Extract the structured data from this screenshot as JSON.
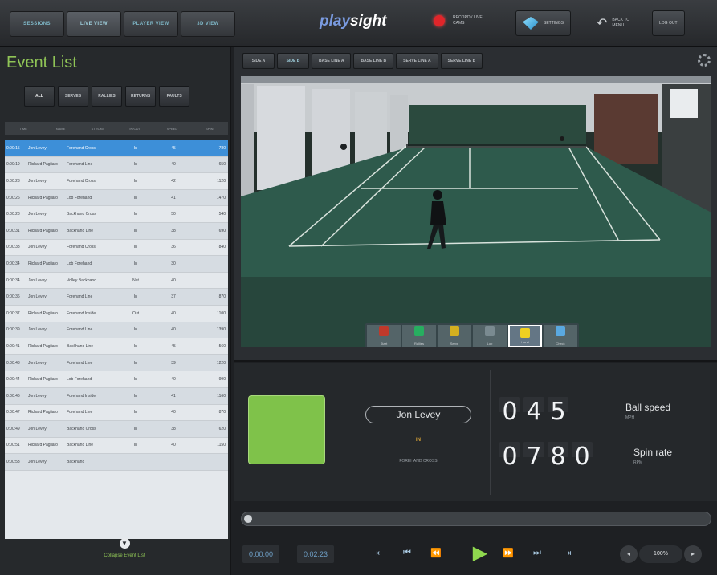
{
  "topbar": {
    "nav_tabs": [
      {
        "label": "SESSIONS",
        "active": false
      },
      {
        "label": "LIVE VIEW",
        "active": true
      },
      {
        "label": "PLAYER VIEW",
        "active": false
      },
      {
        "label": "3D VIEW",
        "active": false
      }
    ],
    "brand_prefix": "play",
    "brand_suffix": "sight",
    "record_text": "RECORD / LIVE CAMS",
    "settings_label": "SETTINGS",
    "back_label": "BACK TO MENU",
    "logout_label": "LOG OUT"
  },
  "event_list": {
    "title": "Event List",
    "filters": [
      "ALL",
      "SERVES",
      "RALLIES",
      "RETURNS",
      "FAULTS"
    ],
    "active_filter": "ALL",
    "columns": [
      "TIME",
      "NAME",
      "STROKE",
      "IN/OUT",
      "SPEED",
      "SPIN"
    ],
    "rows": [
      {
        "time": "0:00:15",
        "name": "Jon Levey",
        "stroke": "Forehand Cross",
        "inout": "In",
        "speed": "45",
        "spin": "780"
      },
      {
        "time": "0:00:19",
        "name": "Richard Pagliaro",
        "stroke": "Forehand Line",
        "inout": "In",
        "speed": "40",
        "spin": "650"
      },
      {
        "time": "0:00:23",
        "name": "Jon Levey",
        "stroke": "Forehand Cross",
        "inout": "In",
        "speed": "42",
        "spin": "1120"
      },
      {
        "time": "0:00:26",
        "name": "Richard Pagliaro",
        "stroke": "Lob Forehand",
        "inout": "In",
        "speed": "41",
        "spin": "1470"
      },
      {
        "time": "0:00:28",
        "name": "Jon Levey",
        "stroke": "Backhand Cross",
        "inout": "In",
        "speed": "50",
        "spin": "540"
      },
      {
        "time": "0:00:31",
        "name": "Richard Pagliaro",
        "stroke": "Backhand Line",
        "inout": "In",
        "speed": "38",
        "spin": "690"
      },
      {
        "time": "0:00:33",
        "name": "Jon Levey",
        "stroke": "Forehand Cross",
        "inout": "In",
        "speed": "36",
        "spin": "840"
      },
      {
        "time": "0:00:34",
        "name": "Richard Pagliaro",
        "stroke": "Lob Forehand",
        "inout": "In",
        "speed": "30",
        "spin": ""
      },
      {
        "time": "0:00:34",
        "name": "Jon Levey",
        "stroke": "Volley Backhand",
        "inout": "Net",
        "speed": "40",
        "spin": ""
      },
      {
        "time": "0:00:36",
        "name": "Jon Levey",
        "stroke": "Forehand Line",
        "inout": "In",
        "speed": "37",
        "spin": "870"
      },
      {
        "time": "0:00:37",
        "name": "Richard Pagliaro",
        "stroke": "Forehand Inside",
        "inout": "Out",
        "speed": "40",
        "spin": "1100"
      },
      {
        "time": "0:00:39",
        "name": "Jon Levey",
        "stroke": "Forehand Line",
        "inout": "In",
        "speed": "40",
        "spin": "1390"
      },
      {
        "time": "0:00:41",
        "name": "Richard Pagliaro",
        "stroke": "Backhand Line",
        "inout": "In",
        "speed": "45",
        "spin": "560"
      },
      {
        "time": "0:00:43",
        "name": "Jon Levey",
        "stroke": "Forehand Line",
        "inout": "In",
        "speed": "39",
        "spin": "1220"
      },
      {
        "time": "0:00:44",
        "name": "Richard Pagliaro",
        "stroke": "Lob Forehand",
        "inout": "In",
        "speed": "40",
        "spin": "990"
      },
      {
        "time": "0:00:46",
        "name": "Jon Levey",
        "stroke": "Forehand Inside",
        "inout": "In",
        "speed": "41",
        "spin": "1160"
      },
      {
        "time": "0:00:47",
        "name": "Richard Pagliaro",
        "stroke": "Forehand Line",
        "inout": "In",
        "speed": "40",
        "spin": "870"
      },
      {
        "time": "0:00:49",
        "name": "Jon Levey",
        "stroke": "Backhand Cross",
        "inout": "In",
        "speed": "38",
        "spin": "620"
      },
      {
        "time": "0:00:51",
        "name": "Richard Pagliaro",
        "stroke": "Backhand Line",
        "inout": "In",
        "speed": "40",
        "spin": "1150"
      },
      {
        "time": "0:00:53",
        "name": "Jon Levey",
        "stroke": "Backhand",
        "inout": "",
        "speed": "",
        "spin": ""
      }
    ],
    "collapse_label": "Collapse Event List"
  },
  "video": {
    "camera_tabs": [
      "SIDE A",
      "SIDE B",
      "BASE LINE A",
      "BASE LINE B",
      "SERVE LINE A",
      "SERVE LINE B"
    ],
    "active_camera": "SIDE B",
    "tags": [
      {
        "label": "Start",
        "color": "#c0392b"
      },
      {
        "label": "Rallies",
        "color": "#27ae60"
      },
      {
        "label": "Serve",
        "color": "#d4b020"
      },
      {
        "label": "Lob",
        "color": "#7a8a90"
      },
      {
        "label": "Hand",
        "color": "#f0d020"
      },
      {
        "label": "Check",
        "color": "#5aa8e0"
      }
    ],
    "active_tag": "Hand"
  },
  "shot_info": {
    "player": "Jon Levey",
    "result": "IN",
    "stroke": "FOREHAND CROSS",
    "ball_speed_digits": [
      "0",
      "4",
      "5"
    ],
    "ball_speed_label": "Ball speed",
    "ball_speed_unit": "MPH",
    "spin_rate_digits": [
      "0",
      "7",
      "8",
      "0"
    ],
    "spin_rate_label": "Spin rate",
    "spin_rate_unit": "RPM",
    "swatch_color": "#7fc24a"
  },
  "playback": {
    "current_time": "0:00:00",
    "total_time": "0:02:23",
    "progress": 0.0,
    "speed": "100%"
  }
}
